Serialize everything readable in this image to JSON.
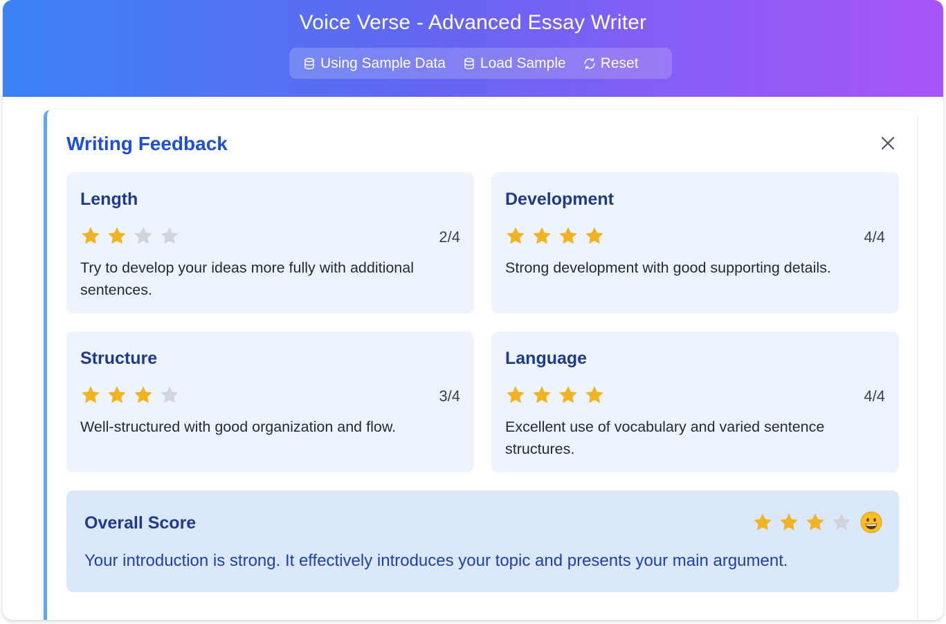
{
  "app": {
    "title": "Voice Verse - Advanced Essay Writer"
  },
  "toolbar": {
    "sample_status_label": "Using Sample Data",
    "load_sample_label": "Load Sample",
    "reset_label": "Reset"
  },
  "feedback": {
    "title": "Writing Feedback",
    "categories": [
      {
        "name": "Length",
        "rating": 2,
        "max": 4,
        "score_text": "2/4",
        "comment": "Try to develop your ideas more fully with additional sentences."
      },
      {
        "name": "Development",
        "rating": 4,
        "max": 4,
        "score_text": "4/4",
        "comment": "Strong development with good supporting details."
      },
      {
        "name": "Structure",
        "rating": 3,
        "max": 4,
        "score_text": "3/4",
        "comment": "Well-structured with good organization and flow."
      },
      {
        "name": "Language",
        "rating": 4,
        "max": 4,
        "score_text": "4/4",
        "comment": "Excellent use of vocabulary and varied sentence structures."
      }
    ],
    "overall": {
      "title": "Overall Score",
      "rating": 3,
      "max": 4,
      "emoji_icon": "grinning-face-icon",
      "comment": "Your introduction is strong. It effectively introduces your topic and presents your main argument."
    }
  },
  "colors": {
    "star_filled": "#f0b322",
    "star_empty": "#d1d5db",
    "accent_blue": "#1d4ed8",
    "header_gradient_start": "#3b82f6",
    "header_gradient_end": "#a855f7"
  }
}
